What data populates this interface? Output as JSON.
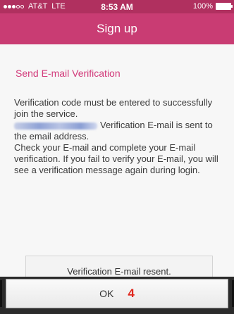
{
  "status_bar": {
    "carrier": "AT&T",
    "network": "LTE",
    "time": "8:53 AM",
    "battery": "100%"
  },
  "nav": {
    "title": "Sign up"
  },
  "verification": {
    "heading": "Send E-mail Verification",
    "line1": "Verification code must be entered to successfully join the service.",
    "line2_suffix": "Verification E-mail is sent to the email address.",
    "line3": "Check your E-mail and complete your E-mail verification. If you fail to verify your E-mail, you will see a verification message again during login.",
    "resend_label": "Verification E-mail resent."
  },
  "footer": {
    "ok_label": "OK",
    "step_number": "4"
  }
}
